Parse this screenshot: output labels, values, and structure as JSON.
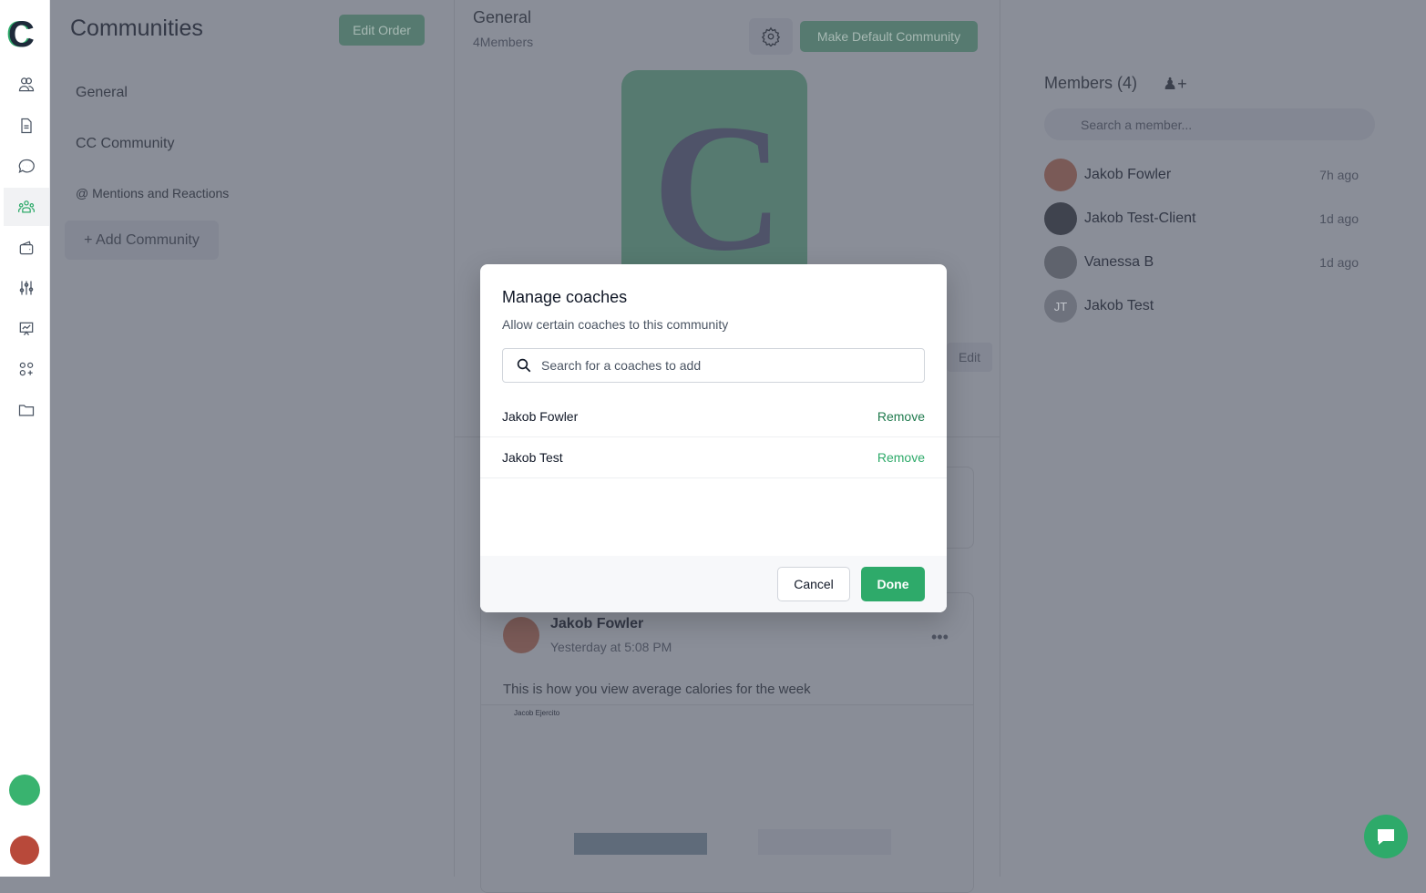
{
  "sidebar": {
    "logo": "C",
    "icons": [
      "clients-icon",
      "documents-icon",
      "messages-icon",
      "communities-icon",
      "wallet-icon",
      "sliders-icon",
      "presentation-icon",
      "apps-icon",
      "folder-icon"
    ],
    "active": "communities-icon"
  },
  "communities": {
    "title": "Communities",
    "edit_order": "Edit Order",
    "items": [
      "General",
      "CC Community",
      "@ Mentions and Reactions"
    ],
    "add": "+ Add Community"
  },
  "community": {
    "name": "General",
    "members": "4Members",
    "make_default": "Make Default Community",
    "edit": "Edit",
    "post": {
      "author": "Jakob Fowler",
      "time": "Yesterday at 5:08 PM",
      "text": "This is how you view average calories for the week",
      "embed_name": "Jacob Ejercito"
    }
  },
  "members": {
    "title": "Members (4)",
    "search_placeholder": "Search a member...",
    "list": [
      {
        "name": "Jakob Fowler",
        "time": "7h ago",
        "initials": ""
      },
      {
        "name": "Jakob Test-Client",
        "time": "1d ago",
        "initials": ""
      },
      {
        "name": "Vanessa B",
        "time": "1d ago",
        "initials": ""
      },
      {
        "name": "Jakob Test",
        "time": "",
        "initials": "JT"
      }
    ]
  },
  "modal": {
    "title": "Manage coaches",
    "subtitle": "Allow certain coaches to this community",
    "search_placeholder": "Search for a coaches to add",
    "coaches": [
      {
        "name": "Jakob Fowler",
        "action": "Remove"
      },
      {
        "name": "Jakob Test",
        "action": "Remove"
      }
    ],
    "cancel": "Cancel",
    "done": "Done"
  },
  "colors": {
    "accent": "#2eaa6a"
  }
}
